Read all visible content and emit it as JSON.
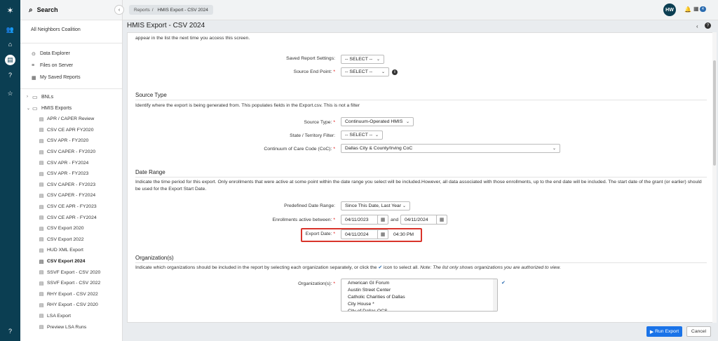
{
  "sidebar": {
    "search_label": "Search",
    "org_name": "All Neighbors Coalition",
    "links": [
      {
        "label": "Data Explorer",
        "icon": "data-explorer-icon"
      },
      {
        "label": "Files on Server",
        "icon": "files-icon"
      },
      {
        "label": "My Saved Reports",
        "icon": "saved-reports-icon"
      }
    ],
    "folders": [
      {
        "label": "BNLs",
        "expanded": false
      },
      {
        "label": "HMIS Exports",
        "expanded": true
      }
    ],
    "reports": [
      "APR / CAPER Review",
      "CSV CE APR FY2020",
      "CSV APR - FY2020",
      "CSV CAPER - FY2020",
      "CSV APR - FY2024",
      "CSV APR - FY2023",
      "CSV CAPER - FY2023",
      "CSV CAPER - FY2024",
      "CSV CE APR - FY2023",
      "CSV CE APR - FY2024",
      "CSV Export 2020",
      "CSV Export 2022",
      "HUD XML Export",
      "CSV Export 2024",
      "SSVF Export - CSV 2020",
      "SSVF Export - CSV 2022",
      "RHY Export - CSV 2022",
      "RHY Export - CSV 2020",
      "LSA Export",
      "Preview LSA Runs"
    ],
    "current_report": "CSV Export 2024"
  },
  "topbar": {
    "breadcrumb_root": "Reports",
    "breadcrumb_sep": "/",
    "breadcrumb_current": "HMIS Export - CSV 2024",
    "avatar_initials": "HW",
    "badge_count": "4"
  },
  "page": {
    "title": "HMIS Export - CSV 2024",
    "intro_line1": "appear in the list the next time you access this screen.",
    "saved_settings_label": "Saved Report Settings:",
    "saved_settings_value": "-- SELECT --",
    "source_endpoint_label": "Source End Point:",
    "source_endpoint_value": "-- SELECT --"
  },
  "source_type": {
    "heading": "Source Type",
    "desc": "Identify where the export is being generated from. This populates fields in the Export.csv. This is not a filter",
    "type_label": "Source Type:",
    "type_value": "Continuum-Operated HMIS",
    "state_label": "State / Territory Filter:",
    "state_value": "-- SELECT --",
    "coc_label": "Continuum of Care Code (CoC):",
    "coc_value": "Dallas City & County/Irving CoC"
  },
  "date_range": {
    "heading": "Date Range",
    "desc": "Indicate the time period for this export. Only enrollments that were active at some point within the date range you select will be included.However, all data associated with those enrollments, up to the end date will be included. The start date of the grant (or earlier) should be used for the Export Start Date.",
    "predefined_label": "Predefined Date Range:",
    "predefined_value": "Since This Date, Last Year",
    "active_label": "Enrollments active between:",
    "start_date": "04/11/2023",
    "and_label": "and",
    "end_date": "04/11/2024",
    "export_date_label": "Export Date:",
    "export_date": "04/11/2024",
    "export_time": "04:30 PM"
  },
  "organizations": {
    "heading": "Organization(s)",
    "desc_prefix": "Indicate which organizations should be included in the report by selecting each organization separately, or click the",
    "desc_mid": "icon to select all.",
    "desc_note": "Note: The list only shows organizations you are authorized to view.",
    "label": "Organization(s):",
    "items": [
      "American GI Forum",
      "Austin Street Center",
      "Catholic Charities of Dallas",
      "City House *",
      "City of Dallas OCS"
    ]
  },
  "footer": {
    "run_label": "Run Export",
    "cancel_label": "Cancel"
  },
  "colors": {
    "rail": "#0b3e52",
    "primary": "#1a73e8",
    "highlight": "#d9342b"
  }
}
